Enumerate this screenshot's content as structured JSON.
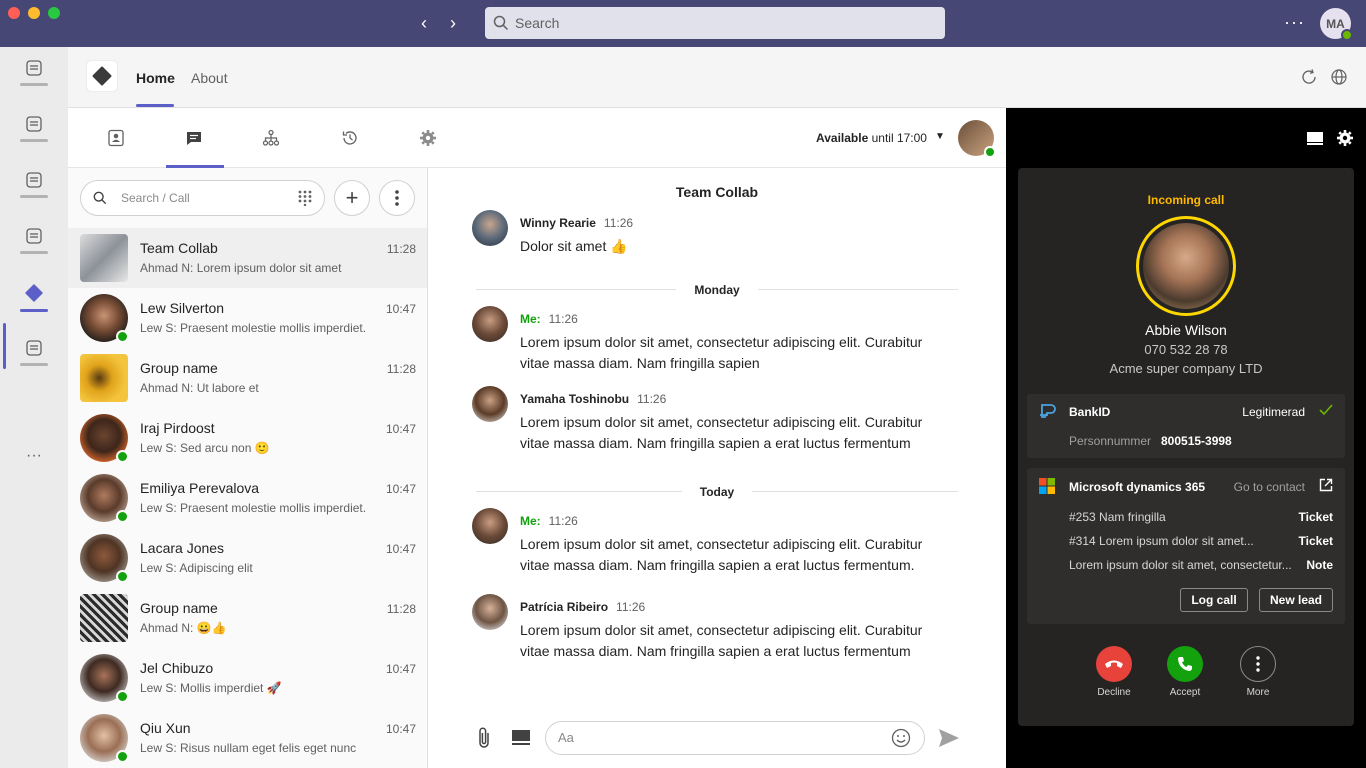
{
  "titlebar": {
    "search_placeholder": "Search",
    "user_initials": "MA"
  },
  "app": {
    "tabs": [
      {
        "label": "Home",
        "active": true
      },
      {
        "label": "About",
        "active": false
      }
    ]
  },
  "toolbar": {
    "status_label": "Available",
    "status_until": "until 17:00"
  },
  "chatlist": {
    "search_placeholder": "Search / Call",
    "items": [
      {
        "name": "Team Collab",
        "preview": "Ahmad N: Lorem ipsum dolor sit amet",
        "time": "11:28"
      },
      {
        "name": "Lew Silverton",
        "preview": "Lew S: Praesent molestie mollis imperdiet.",
        "time": "10:47"
      },
      {
        "name": "Group name",
        "preview": "Ahmad N: Ut labore et",
        "time": "11:28"
      },
      {
        "name": "Iraj Pirdoost",
        "preview": "Lew S: Sed arcu non 🙂",
        "time": "10:47"
      },
      {
        "name": "Emiliya Perevalova",
        "preview": "Lew S: Praesent molestie mollis imperdiet.",
        "time": "10:47"
      },
      {
        "name": "Lacara Jones",
        "preview": "Lew S: Adipiscing elit",
        "time": "10:47"
      },
      {
        "name": "Group name",
        "preview": "Ahmad N: 😀👍",
        "time": "11:28"
      },
      {
        "name": "Jel Chibuzo",
        "preview": "Lew S: Mollis imperdiet 🚀",
        "time": "10:47"
      },
      {
        "name": "Qiu Xun",
        "preview": "Lew S: Risus nullam eget felis eget nunc",
        "time": "10:47"
      }
    ]
  },
  "conversation": {
    "title": "Team Collab",
    "messages": [
      {
        "sender": "Winny Rearie",
        "time": "11:26",
        "text": "Dolor sit amet 👍"
      },
      {
        "sender": "Me:",
        "time": "11:26",
        "text": "Lorem ipsum dolor sit amet, consectetur adipiscing elit. Curabitur vitae massa diam. Nam fringilla sapien"
      },
      {
        "sender": "Yamaha Toshinobu",
        "time": "11:26",
        "text": "Lorem ipsum dolor sit amet, consectetur adipiscing elit. Curabitur vitae massa diam. Nam fringilla sapien a erat luctus fermentum"
      },
      {
        "sender": "Me:",
        "time": "11:26",
        "text": "Lorem ipsum dolor sit amet, consectetur adipiscing elit. Curabitur vitae massa diam. Nam fringilla sapien a erat luctus fermentum."
      },
      {
        "sender": "Patrícia Ribeiro",
        "time": "11:26",
        "text": "Lorem ipsum dolor sit amet, consectetur adipiscing elit. Curabitur vitae massa diam. Nam fringilla sapien a erat luctus fermentum"
      }
    ],
    "dividers": [
      "Monday",
      "Today"
    ],
    "compose_placeholder": "Aa"
  },
  "call": {
    "label": "Incoming call",
    "caller_name": "Abbie Wilson",
    "caller_number": "070 532 28 78",
    "caller_company": "Acme super company LTD",
    "bankid": {
      "title": "BankID",
      "status": "Legitimerad",
      "field_label": "Personnummer",
      "field_value": "800515-3998"
    },
    "dynamics": {
      "title": "Microsoft dynamics 365",
      "link": "Go to contact",
      "rows": [
        {
          "text": "#253  Nam fringilla",
          "type": "Ticket"
        },
        {
          "text": "#314 Lorem ipsum dolor sit amet...",
          "type": "Ticket"
        },
        {
          "text": "Lorem ipsum dolor sit amet, consectetur...",
          "type": "Note"
        }
      ],
      "log_call": "Log call",
      "new_lead": "New lead"
    },
    "actions": {
      "decline": "Decline",
      "accept": "Accept",
      "more": "More"
    }
  },
  "colors": {
    "titlebar": "#464775",
    "accent": "#5b5fc7",
    "online": "#13a10e",
    "decline": "#e8433a",
    "accept": "#13a10e",
    "incoming": "#ffb900"
  }
}
